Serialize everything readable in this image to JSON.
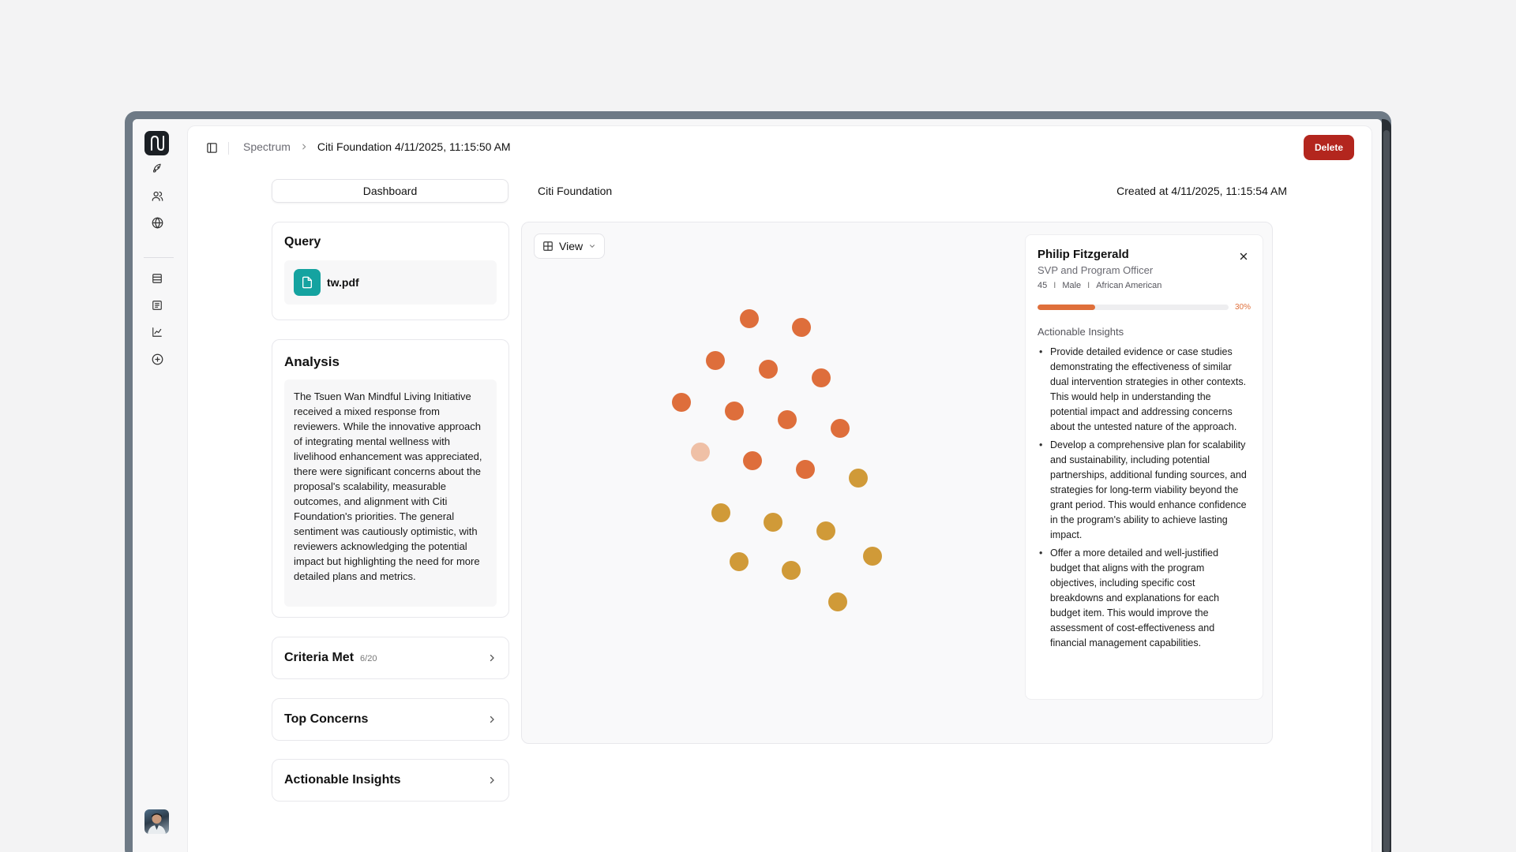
{
  "breadcrumb": {
    "root": "Spectrum",
    "current": "Citi Foundation 4/11/2025, 11:15:50 AM"
  },
  "toolbar": {
    "delete_label": "Delete"
  },
  "header": {
    "tab_label": "Dashboard",
    "org_name": "Citi Foundation",
    "created_at": "Created at 4/11/2025, 11:15:54 AM"
  },
  "query": {
    "title": "Query",
    "file_name": "tw.pdf"
  },
  "analysis": {
    "title": "Analysis",
    "text": "The Tsuen Wan Mindful Living Initiative received a mixed response from reviewers. While the innovative approach of integrating mental wellness with livelihood enhancement was appreciated, there were significant concerns about the proposal's scalability, measurable outcomes, and alignment with Citi Foundation's priorities. The general sentiment was cautiously optimistic, with reviewers acknowledging the potential impact but highlighting the need for more detailed plans and metrics."
  },
  "sections": {
    "criteria_met": {
      "label": "Criteria Met",
      "count": "6/20"
    },
    "top_concerns": {
      "label": "Top Concerns"
    },
    "actionable_insights": {
      "label": "Actionable Insights"
    }
  },
  "view_button": {
    "label": "View"
  },
  "scatter": {
    "colors": {
      "orange": "#de6e3b",
      "gold": "#d09a38",
      "selected": "#efc0a6"
    },
    "groups": [
      "orange",
      "orange",
      "orange",
      "orange",
      "orange",
      "orange",
      "orange",
      "orange",
      "orange",
      "selected",
      "orange",
      "orange",
      "gold",
      "gold",
      "gold",
      "gold",
      "gold",
      "gold",
      "gold",
      "gold"
    ]
  },
  "person": {
    "name": "Philip Fitzgerald",
    "role": "SVP and Program Officer",
    "age": "45",
    "gender": "Male",
    "ethnicity": "African American",
    "meta_sep": "I",
    "progress": 0.3,
    "progress_label": "30%",
    "insights_heading": "Actionable Insights",
    "insights": [
      "Provide detailed evidence or case studies demonstrating the effectiveness of similar dual intervention strategies in other contexts. This would help in understanding the potential impact and addressing concerns about the untested nature of the approach.",
      "Develop a comprehensive plan for scalability and sustainability, including potential partnerships, additional funding sources, and strategies for long-term viability beyond the grant period. This would enhance confidence in the program's ability to achieve lasting impact.",
      "Offer a more detailed and well-justified budget that aligns with the program objectives, including specific cost breakdowns and explanations for each budget item. This would improve the assessment of cost-effectiveness and financial management capabilities."
    ]
  },
  "colors": {
    "accent": "#df6f3a",
    "danger": "#b3261e",
    "file_icon": "#15a3a0"
  },
  "icons": {
    "rail": [
      "rocket-icon",
      "users-icon",
      "globe-icon",
      "database-icon",
      "document-icon",
      "chart-icon",
      "plus-circle-icon"
    ]
  }
}
